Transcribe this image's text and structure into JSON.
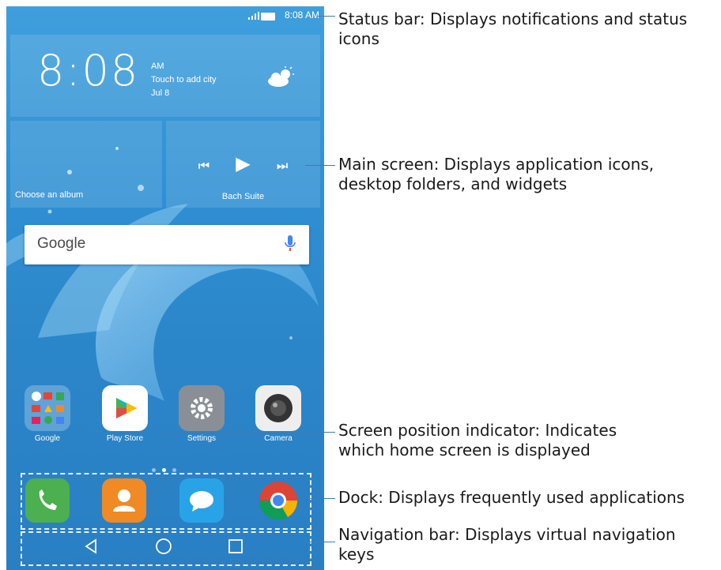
{
  "status_bar": {
    "time": "8:08 AM"
  },
  "clock_widget": {
    "time": "8:08",
    "ampm": "AM",
    "city": "Touch to add city",
    "date": "Jul 8"
  },
  "album_widget": {
    "label": "Choose an album"
  },
  "music_widget": {
    "title": "Bach Suite"
  },
  "search_bar": {
    "logo": "Google"
  },
  "apps": [
    {
      "label": "Google"
    },
    {
      "label": "Play Store"
    },
    {
      "label": "Settings"
    },
    {
      "label": "Camera"
    }
  ],
  "callouts": {
    "status_bar": "Status bar: Displays notifications and status icons",
    "main_screen": "Main screen: Displays application icons, desktop folders, and widgets",
    "indicator": "Screen position indicator: Indicates which home screen is displayed",
    "dock": "Dock: Displays frequently used applications",
    "nav_bar": "Navigation bar: Displays virtual navigation keys"
  },
  "colors": {
    "wallpaper": "#2f8fd2",
    "phone_app": "#4caf50",
    "contacts_app": "#f08a24",
    "messages_app": "#29a3e8",
    "leader": "#3a7fb0"
  }
}
